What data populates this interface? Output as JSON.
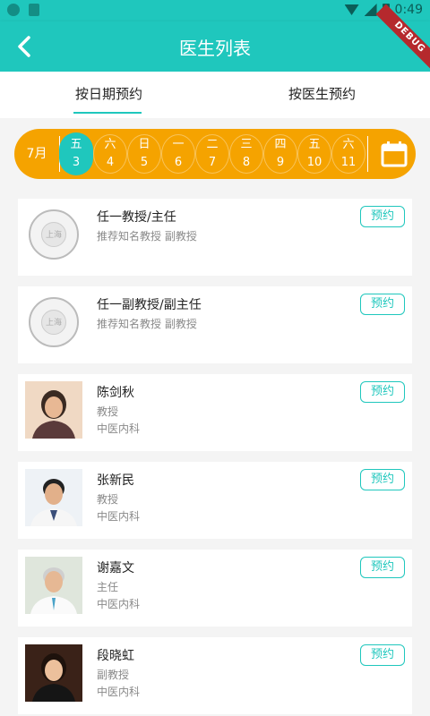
{
  "status_bar": {
    "time": "0:49",
    "icons": [
      "notification-icon",
      "sim-card-icon",
      "wifi-icon",
      "signal-icon",
      "battery-icon"
    ]
  },
  "app_bar": {
    "title": "医生列表",
    "back_icon": "arrow-back-icon",
    "debug_banner": "DEBUG",
    "color": "#1fc7bd"
  },
  "tabs": [
    {
      "label": "按日期预约",
      "selected": true
    },
    {
      "label": "按医生预约",
      "selected": false
    }
  ],
  "date_strip": {
    "month": "7月",
    "color": "#f5a300",
    "selected_color": "#1fc7bd",
    "days": [
      {
        "weekday": "五",
        "date": "3",
        "selected": true
      },
      {
        "weekday": "六",
        "date": "4",
        "selected": false
      },
      {
        "weekday": "日",
        "date": "5",
        "selected": false
      },
      {
        "weekday": "一",
        "date": "6",
        "selected": false
      },
      {
        "weekday": "二",
        "date": "7",
        "selected": false
      },
      {
        "weekday": "三",
        "date": "8",
        "selected": false
      },
      {
        "weekday": "四",
        "date": "9",
        "selected": false
      },
      {
        "weekday": "五",
        "date": "10",
        "selected": false
      },
      {
        "weekday": "六",
        "date": "11",
        "selected": false
      }
    ],
    "calendar_icon": "calendar-icon"
  },
  "doctors": [
    {
      "name": "任一教授/主任",
      "line1": "推荐知名教授 副教授",
      "line2": "",
      "photo": "seal",
      "seal_text": "上海",
      "button": "预约"
    },
    {
      "name": "任一副教授/副主任",
      "line1": "推荐知名教授 副教授",
      "line2": "",
      "photo": "seal",
      "seal_text": "上海",
      "button": "预约"
    },
    {
      "name": "陈剑秋",
      "line1": "教授",
      "line2": "中医内科",
      "photo": "portrait",
      "button": "预约"
    },
    {
      "name": "张新民",
      "line1": "教授",
      "line2": "中医内科",
      "photo": "portrait",
      "button": "预约"
    },
    {
      "name": "谢嘉文",
      "line1": "主任",
      "line2": "中医内科",
      "photo": "portrait",
      "button": "预约"
    },
    {
      "name": "段晓虹",
      "line1": "副教授",
      "line2": "中医内科",
      "photo": "portrait",
      "button": "预约"
    }
  ]
}
